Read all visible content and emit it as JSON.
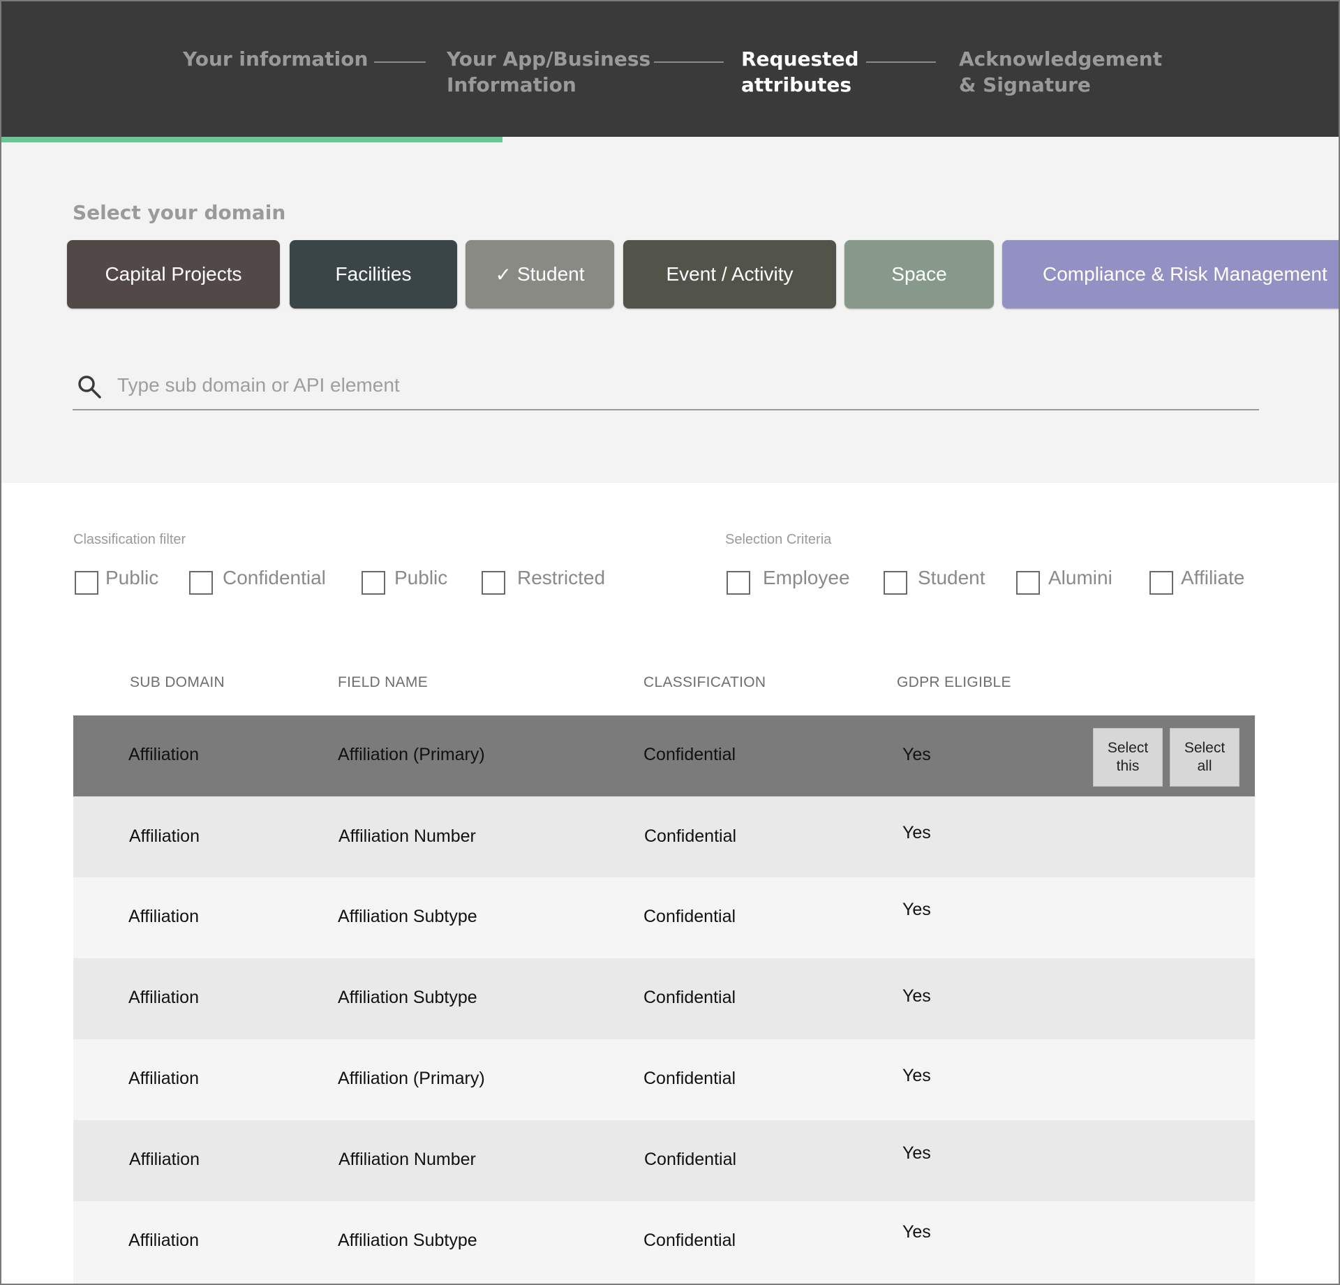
{
  "stepper": {
    "steps": [
      {
        "label": "Your information",
        "state": "done"
      },
      {
        "label": "Your App/Business\nInformation",
        "state": "done"
      },
      {
        "label": "Requested\nattributes",
        "state": "active"
      },
      {
        "label": "Acknowledgement\n& Signature",
        "state": "upcoming"
      }
    ],
    "progress_fraction": 0.375,
    "progress_color": "#6cc596"
  },
  "domain": {
    "title": "Select your domain",
    "chips": [
      {
        "label": "Capital Projects",
        "color": "#524848",
        "selected": false
      },
      {
        "label": "Facilities",
        "color": "#3a4548",
        "selected": false
      },
      {
        "label": "Student",
        "color": "#898a83",
        "selected": true,
        "check": "✓"
      },
      {
        "label": "Event / Activity",
        "color": "#525349",
        "selected": false
      },
      {
        "label": "Space",
        "color": "#879989",
        "selected": false
      },
      {
        "label": "Compliance & Risk Management",
        "color": "#9391c4",
        "selected": false
      }
    ],
    "search_placeholder": "Type sub domain or API element",
    "search_value": ""
  },
  "filters": {
    "classification": {
      "label": "Classification filter",
      "options": [
        "Public",
        "Confidential",
        "Public",
        "Restricted"
      ]
    },
    "selection": {
      "label": "Selection Criteria",
      "options": [
        "Employee",
        "Student",
        "Alumini",
        "Affiliate"
      ]
    }
  },
  "table": {
    "headers": [
      "SUB DOMAIN",
      "FIELD NAME",
      "CLASSIFICATION",
      "GDPR ELIGIBLE"
    ],
    "rows": [
      {
        "sub_domain": "Affiliation",
        "field_name": "Affiliation (Primary)",
        "classification": "Confidential",
        "gdpr": "Yes",
        "selected": true
      },
      {
        "sub_domain": "Affiliation",
        "field_name": "Affiliation Number",
        "classification": "Confidential",
        "gdpr": "Yes"
      },
      {
        "sub_domain": "Affiliation",
        "field_name": "Affiliation Subtype",
        "classification": "Confidential",
        "gdpr": "Yes"
      },
      {
        "sub_domain": "Affiliation",
        "field_name": "Affiliation Subtype",
        "classification": "Confidential",
        "gdpr": "Yes"
      },
      {
        "sub_domain": "Affiliation",
        "field_name": "Affiliation (Primary)",
        "classification": "Confidential",
        "gdpr": "Yes"
      },
      {
        "sub_domain": "Affiliation",
        "field_name": "Affiliation Number",
        "classification": "Confidential",
        "gdpr": "Yes"
      },
      {
        "sub_domain": "Affiliation",
        "field_name": "Affiliation Subtype",
        "classification": "Confidential",
        "gdpr": "Yes"
      }
    ],
    "row_actions": {
      "select_this": "Select\nthis",
      "select_all": "Select\nall"
    }
  }
}
